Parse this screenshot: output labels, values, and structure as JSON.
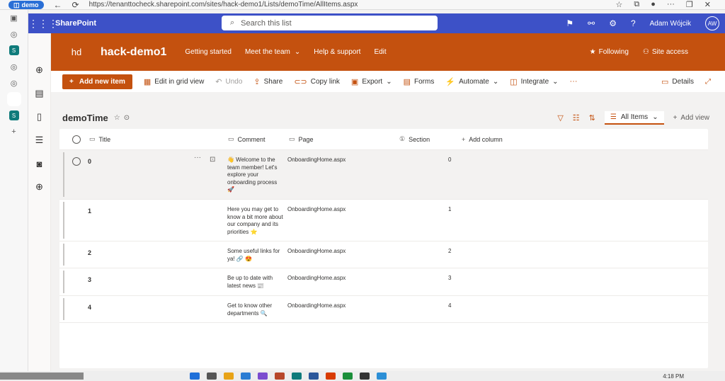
{
  "browser": {
    "tab_label": "demo",
    "url": "https://tenanttocheck.sharepoint.com/sites/hack-demo1/Lists/demoTime/AllItems.aspx",
    "back_icon": "←",
    "refresh_icon": "⟳"
  },
  "suite": {
    "app_name": "SharePoint",
    "search_placeholder": "Search this list",
    "user_name": "Adam Wójcik",
    "user_initials": "AW",
    "help_glyph": "?"
  },
  "site": {
    "logo_text": "hd",
    "name": "hack-demo1",
    "nav": [
      "Getting started",
      "Meet the team",
      "Help & support",
      "Edit"
    ],
    "following_label": "Following",
    "site_access_label": "Site access"
  },
  "commands": {
    "add_new_item": "Add new item",
    "edit_grid": "Edit in grid view",
    "undo": "Undo",
    "share": "Share",
    "copy_link": "Copy link",
    "export": "Export",
    "forms": "Forms",
    "automate": "Automate",
    "integrate": "Integrate",
    "more": "···",
    "details": "Details"
  },
  "list": {
    "title": "demoTime",
    "view_name": "All Items",
    "add_view": "Add view",
    "columns": {
      "title": "Title",
      "comment": "Comment",
      "page": "Page",
      "section": "Section",
      "add_column": "Add column"
    },
    "rows": [
      {
        "title": "0",
        "comment": "👋 Welcome to the team member! Let's explore your onboarding process 🚀",
        "page": "OnboardingHome.aspx",
        "section": "0"
      },
      {
        "title": "1",
        "comment": "Here you may get to know a bit more about our company and its priorities ⭐",
        "page": "OnboardingHome.aspx",
        "section": "1"
      },
      {
        "title": "2",
        "comment": "Some useful links for ya! 🔗 😍",
        "page": "OnboardingHome.aspx",
        "section": "2"
      },
      {
        "title": "3",
        "comment": "Be up to date with latest news 📰",
        "page": "OnboardingHome.aspx",
        "section": "3"
      },
      {
        "title": "4",
        "comment": "Get to know other departments 🔍",
        "page": "OnboardingHome.aspx",
        "section": "4"
      }
    ]
  },
  "taskbar": {
    "time": "4:18 PM"
  },
  "colors": {
    "suite_bar": "#3d51c7",
    "site_header": "#c4510f",
    "accent": "#c4510f"
  }
}
